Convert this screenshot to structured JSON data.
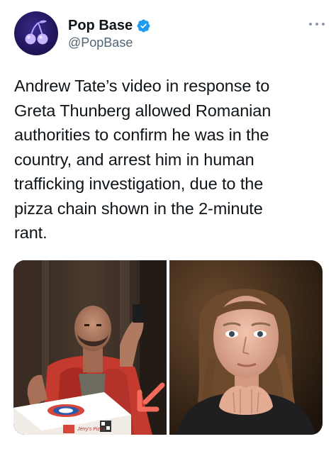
{
  "tweet": {
    "display_name": "Pop Base",
    "handle": "@PopBase",
    "verified_icon": "verified-badge-icon",
    "more_icon": "more-options-icon",
    "avatar_icon": "cherry-logo-icon",
    "text_lines": [
      "Andrew Tate’s video in response to",
      "Greta Thunberg allowed Romanian",
      "authorities to confirm he was in the",
      "country, and arrest him in human",
      "trafficking investigation, due to the",
      "pizza chain shown in the 2-minute",
      "rant."
    ],
    "media": [
      {
        "description_icon": "photo-man-pizza-box",
        "pizza_box_text": "Jerry's Pizza"
      },
      {
        "description_icon": "photo-girl-portrait"
      }
    ]
  },
  "colors": {
    "text": "#0f1419",
    "secondary": "#536471",
    "verified_blue": "#1d9bf0",
    "avatar_bg": "#24175e",
    "annotation_arrow": "#f26b5b"
  }
}
